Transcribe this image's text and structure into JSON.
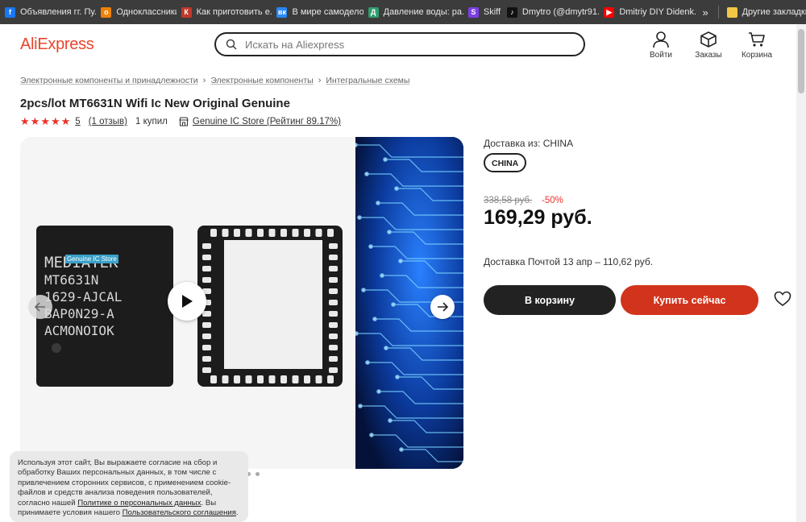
{
  "bookmarks": {
    "items": [
      {
        "label": "Объявления гг. Пу...",
        "icon": "facebook-icon",
        "color": "#1877f2",
        "glyph": "f"
      },
      {
        "label": "Одноклассники",
        "icon": "odnoklassniki-icon",
        "color": "#ee8208",
        "glyph": "о"
      },
      {
        "label": "Как приготовить е...",
        "icon": "recipe-icon",
        "color": "#c0392b",
        "glyph": "К"
      },
      {
        "label": "В мире самоделок",
        "icon": "vk-icon",
        "color": "#2787f5",
        "glyph": "вк"
      },
      {
        "label": "Давление воды: ра...",
        "icon": "gauge-icon",
        "color": "#2e9e6f",
        "glyph": "Д"
      },
      {
        "label": "Skiff",
        "icon": "skiff-icon",
        "color": "#7b3fe4",
        "glyph": "S"
      },
      {
        "label": "Dmytro (@dmytr91...",
        "icon": "tiktok-icon",
        "color": "#111111",
        "glyph": "♪"
      },
      {
        "label": "Dmitriy DIY Didenk...",
        "icon": "youtube-icon",
        "color": "#ff0000",
        "glyph": "▶"
      }
    ],
    "more": "»",
    "folder_label": "Другие закладки"
  },
  "header": {
    "logo": "AliExpress",
    "search_placeholder": "Искать на Aliexpress",
    "login": "Войти",
    "orders": "Заказы",
    "cart": "Корзина"
  },
  "breadcrumb": [
    "Электронные компоненты и принадлежности",
    "Электронные компоненты",
    "Интегральные схемы"
  ],
  "product": {
    "title": "2pcs/lot MT6631N Wifi Ic New Original Genuine",
    "rating": "5",
    "stars": 5,
    "reviews": "(1 отзыв)",
    "sold": "1 купил",
    "store": "Genuine IC Store (Рейтинг 89.17%)"
  },
  "gallery": {
    "chip_label": "Genuine IC Store",
    "chip_text_lines": [
      "MEDIATEK",
      "MT6631N",
      "1629-AJCAL",
      "BAP0N29-A",
      "ACMONOIOK"
    ],
    "dots_count": 3
  },
  "purchase": {
    "ship_from": "Доставка из: CHINA",
    "country": "CHINA",
    "old_price": "338,58 руб.",
    "discount": "-50%",
    "price": "169,29 руб.",
    "delivery": "Доставка Почтой 13 апр – 110,62 руб.",
    "add_to_cart": "В корзину",
    "buy_now": "Купить сейчас"
  },
  "cookie": {
    "text_1": "Используя этот сайт, Вы выражаете согласие на сбор и обработку Ваших персональных данных, в том числе с привлечением сторонних сервисов, с применением cookie-файлов и средств анализа поведения пользователей, согласно нашей ",
    "link_1": "Политике о персональных данных",
    "text_2": ". Вы принимаете условия нашего ",
    "link_2": "Пользовательского соглашения",
    "text_3": "."
  }
}
